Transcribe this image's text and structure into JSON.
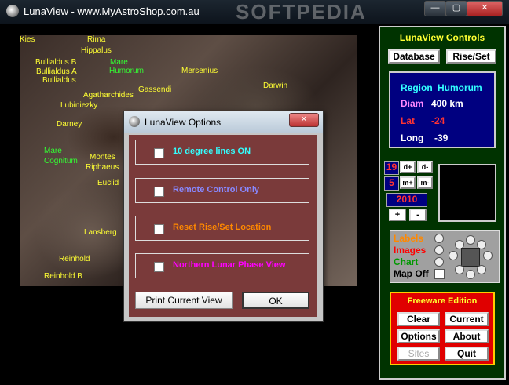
{
  "window": {
    "title": "LunaView - www.MyAstroShop.com.au",
    "controls": {
      "minimize": "—",
      "maximize": "▢",
      "close": "✕"
    }
  },
  "watermark": "SOFTPEDIA",
  "map_labels": [
    {
      "text": "Kies",
      "color": "yellow"
    },
    {
      "text": "Rima",
      "color": "yellow"
    },
    {
      "text": "Hippalus",
      "color": "yellow"
    },
    {
      "text": "Bullialdus B",
      "color": "yellow"
    },
    {
      "text": "Bullialdus A",
      "color": "yellow"
    },
    {
      "text": "Bullialdus",
      "color": "yellow"
    },
    {
      "text": "Mare",
      "color": "green"
    },
    {
      "text": "Humorum",
      "color": "green"
    },
    {
      "text": "Mersenius",
      "color": "yellow"
    },
    {
      "text": "Gassendi",
      "color": "yellow"
    },
    {
      "text": "Agatharchides",
      "color": "yellow"
    },
    {
      "text": "Darwin",
      "color": "yellow"
    },
    {
      "text": "Lubiniezky",
      "color": "yellow"
    },
    {
      "text": "Darney",
      "color": "yellow"
    },
    {
      "text": "Mare",
      "color": "green"
    },
    {
      "text": "Cognitum",
      "color": "green"
    },
    {
      "text": "Montes",
      "color": "yellow"
    },
    {
      "text": "Riphaeus",
      "color": "yellow"
    },
    {
      "text": "Euclid",
      "color": "yellow"
    },
    {
      "text": "Lansberg",
      "color": "yellow"
    },
    {
      "text": "Reinhold",
      "color": "yellow"
    },
    {
      "text": "Reinhold B",
      "color": "yellow"
    }
  ],
  "controls_panel": {
    "title": "LunaView Controls",
    "database_button": "Database",
    "riseset_button": "Rise/Set",
    "region": {
      "region_label": "Region",
      "region_value": "Humorum",
      "diam_label": "Diam",
      "diam_value": "400 km",
      "lat_label": "Lat",
      "lat_value": "-24",
      "long_label": "Long",
      "long_value": "-39"
    },
    "day": {
      "value": "19",
      "plus": "d+",
      "minus": "d-"
    },
    "month": {
      "value": "5",
      "plus": "m+",
      "minus": "m-"
    },
    "year": {
      "value": "2010",
      "plus": "+",
      "minus": "-"
    },
    "layers": [
      {
        "label": "Labels",
        "color": "#ff8800"
      },
      {
        "label": "Images",
        "color": "#ff0000"
      },
      {
        "label": "Chart",
        "color": "#009900"
      },
      {
        "label": "Map Off",
        "color": "#000000"
      }
    ],
    "freeware": {
      "title": "Freeware Edition",
      "clear": "Clear",
      "current": "Current",
      "options": "Options",
      "about": "About",
      "sites": "Sites",
      "quit": "Quit"
    }
  },
  "dialog": {
    "title": "LunaView Options",
    "close": "✕",
    "options": [
      {
        "label": "10 degree lines ON",
        "color": "#33ffff",
        "checked": false
      },
      {
        "label": "Remote Control Only",
        "color": "#8888ff",
        "checked": false
      },
      {
        "label": "Reset Rise/Set Location",
        "color": "#ff8800",
        "checked": false
      },
      {
        "label": "Northern Lunar Phase View",
        "color": "#ff00ff",
        "checked": false
      }
    ],
    "print_button": "Print Current View",
    "ok_button": "OK"
  }
}
